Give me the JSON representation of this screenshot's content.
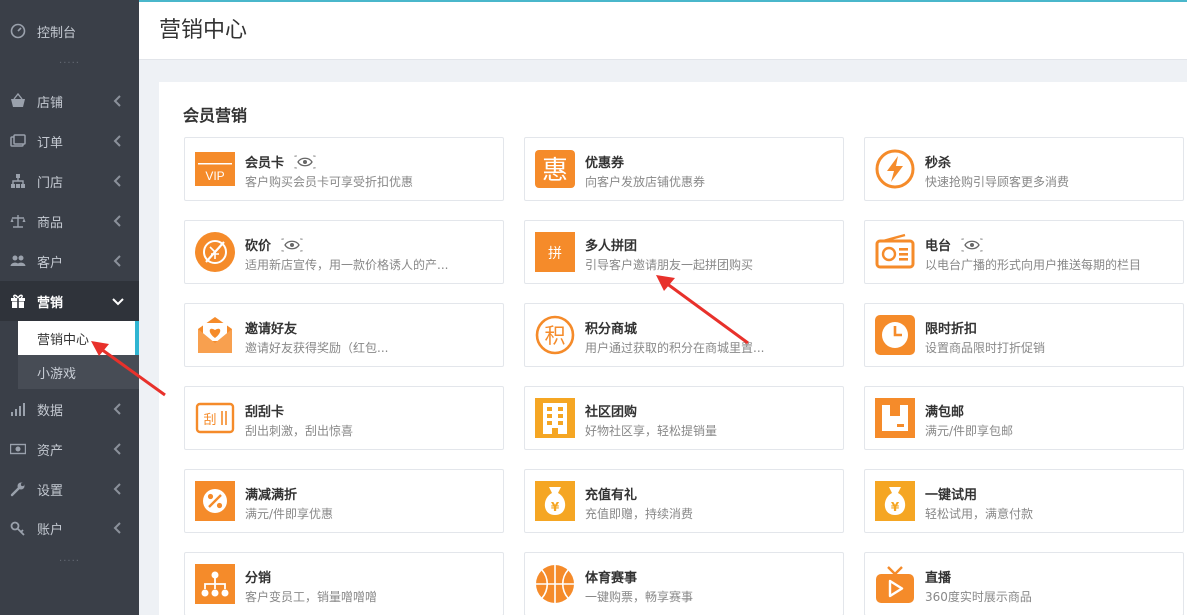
{
  "sidebar": {
    "items": [
      {
        "label": "控制台",
        "icon": "dashboard-icon"
      },
      {
        "label": "店铺",
        "icon": "shop-basket-icon"
      },
      {
        "label": "订单",
        "icon": "order-icon"
      },
      {
        "label": "门店",
        "icon": "store-tree-icon"
      },
      {
        "label": "商品",
        "icon": "scale-icon"
      },
      {
        "label": "客户",
        "icon": "users-icon"
      },
      {
        "label": "营销",
        "icon": "gift-icon"
      },
      {
        "label": "数据",
        "icon": "bar-chart-icon"
      },
      {
        "label": "资产",
        "icon": "money-icon"
      },
      {
        "label": "设置",
        "icon": "wrench-icon"
      },
      {
        "label": "账户",
        "icon": "key-icon"
      }
    ],
    "sub_items": [
      {
        "label": "营销中心"
      },
      {
        "label": "小游戏"
      }
    ],
    "separator": "·····"
  },
  "header": {
    "title": "营销中心"
  },
  "section": {
    "title": "会员营销"
  },
  "colors": {
    "accent": "#f58b2a",
    "sidebar": "#3a3f48",
    "active_border": "#2fb5d2",
    "arrow": "#e8312b"
  },
  "cards": [
    {
      "title": "会员卡",
      "desc": "客户购买会员卡可享受折扣优惠",
      "icon": "vip-icon"
    },
    {
      "title": "优惠券",
      "desc": "向客户发放店铺优惠券",
      "icon": "coupon-icon"
    },
    {
      "title": "秒杀",
      "desc": "快速抢购引导顾客更多消费",
      "icon": "lightning-icon"
    },
    {
      "title": "砍价",
      "desc": "适用新店宣传，用一款价格诱人的产...",
      "icon": "bargain-icon"
    },
    {
      "title": "多人拼团",
      "desc": "引导客户邀请朋友一起拼团购买",
      "icon": "group-buy-icon"
    },
    {
      "title": "电台",
      "desc": "以电台广播的形式向用户推送每期的栏目",
      "icon": "radio-icon"
    },
    {
      "title": "邀请好友",
      "desc": "邀请好友获得奖励（红包...",
      "icon": "invite-icon"
    },
    {
      "title": "积分商城",
      "desc": "用户通过获取的积分在商城里置...",
      "icon": "points-icon"
    },
    {
      "title": "限时折扣",
      "desc": "设置商品限时打折促销",
      "icon": "clock-icon"
    },
    {
      "title": "刮刮卡",
      "desc": "刮出刺激，刮出惊喜",
      "icon": "scratch-card-icon"
    },
    {
      "title": "社区团购",
      "desc": "好物社区享，轻松提销量",
      "icon": "building-icon"
    },
    {
      "title": "满包邮",
      "desc": "满元/件即享包邮",
      "icon": "package-icon"
    },
    {
      "title": "满减满折",
      "desc": "满元/件即享优惠",
      "icon": "percent-icon"
    },
    {
      "title": "充值有礼",
      "desc": "充值即赠，持续消费",
      "icon": "money-bag-icon"
    },
    {
      "title": "一键试用",
      "desc": "轻松试用，满意付款",
      "icon": "trial-bag-icon"
    },
    {
      "title": "分销",
      "desc": "客户变员工，销量噌噌噌",
      "icon": "distribution-icon"
    },
    {
      "title": "体育赛事",
      "desc": "一键购票，畅享赛事",
      "icon": "basketball-icon"
    },
    {
      "title": "直播",
      "desc": "360度实时展示商品",
      "icon": "live-tv-icon"
    }
  ],
  "badges": {
    "coupon_glyph": "惠",
    "group_glyph": "拼",
    "points_glyph": "积",
    "scratch_glyph": "刮",
    "vip_glyph": "VIP",
    "money_glyph": "¥"
  }
}
